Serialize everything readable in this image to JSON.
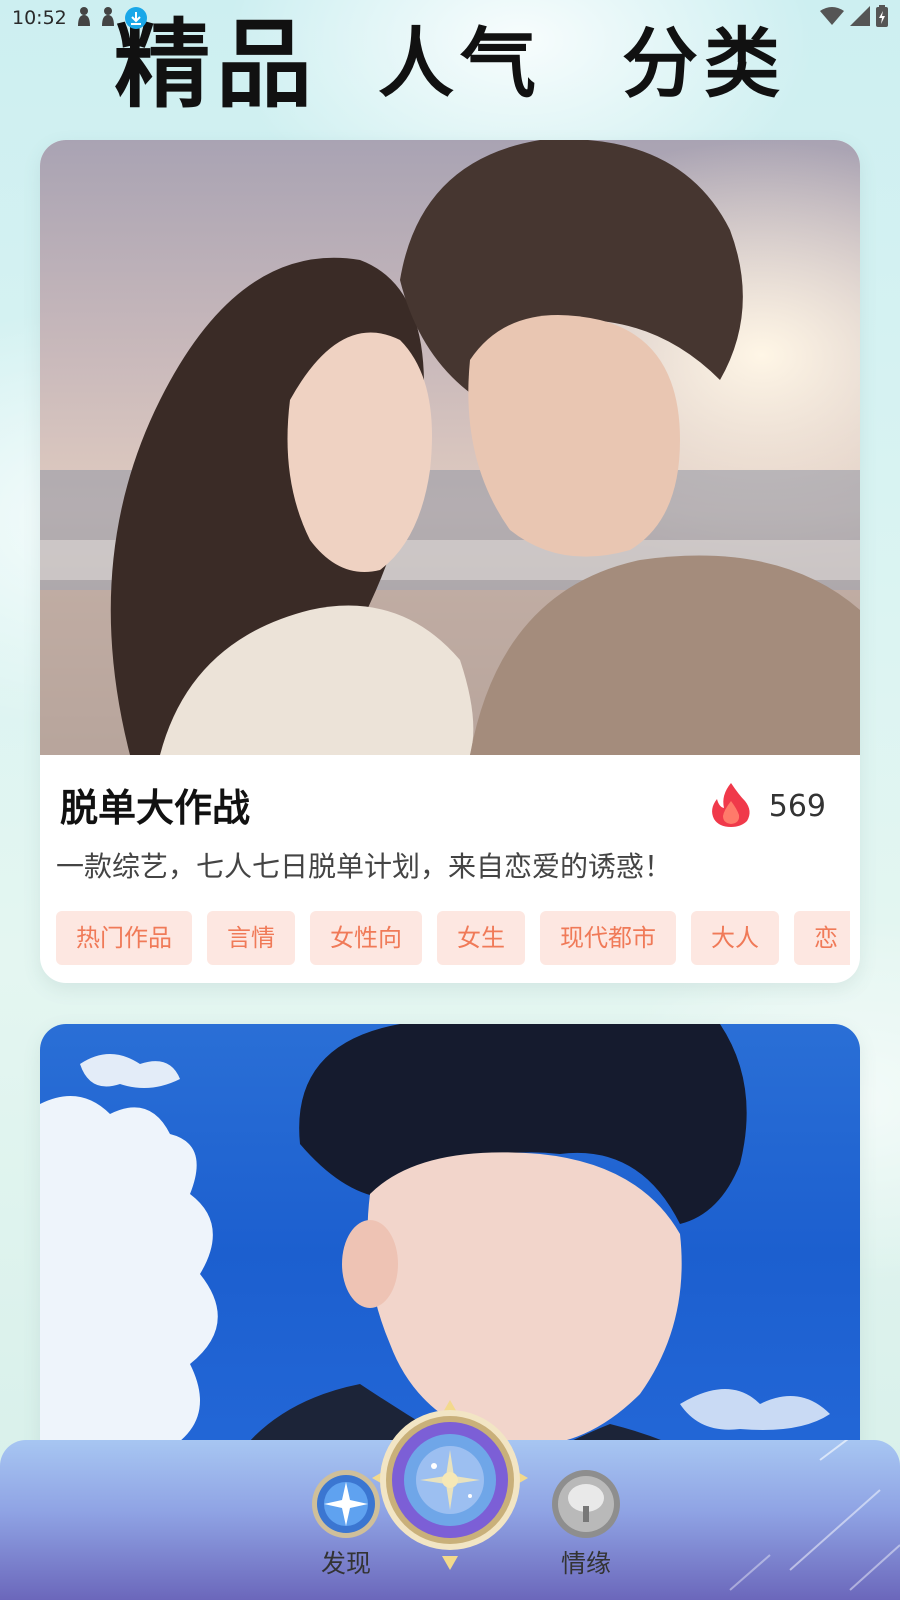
{
  "status_bar": {
    "time": "10:52",
    "icons": [
      "person-silhouette-icon",
      "person-silhouette-icon",
      "download-icon",
      "wifi-icon",
      "signal-icon",
      "battery-icon"
    ]
  },
  "top_tabs": [
    {
      "label": "精品",
      "active": true
    },
    {
      "label": "人气",
      "active": false
    },
    {
      "label": "分类",
      "active": false
    }
  ],
  "cards": [
    {
      "title": "脱单大作战",
      "heat_count": "569",
      "description": "一款综艺，七人七日脱单计划，来自恋爱的诱惑！",
      "tags": [
        "热门作品",
        "言情",
        "女性向",
        "女生",
        "现代都市",
        "大人",
        "恋"
      ],
      "image": "couple-at-beach-sunset-illustration"
    },
    {
      "image": "young-man-blue-sky-illustration"
    }
  ],
  "bottom_nav": {
    "items": [
      {
        "label": "发现",
        "icon": "compass-star-icon"
      },
      {
        "label": "",
        "icon": "magic-orb-icon"
      },
      {
        "label": "情缘",
        "icon": "tree-icon"
      }
    ]
  },
  "colors": {
    "tag_bg": "#fde7e1",
    "tag_text": "#f07a58",
    "heat_icon": "#f0394a",
    "nav_top": "#a7c6f2",
    "nav_bottom": "#6b67bb"
  }
}
